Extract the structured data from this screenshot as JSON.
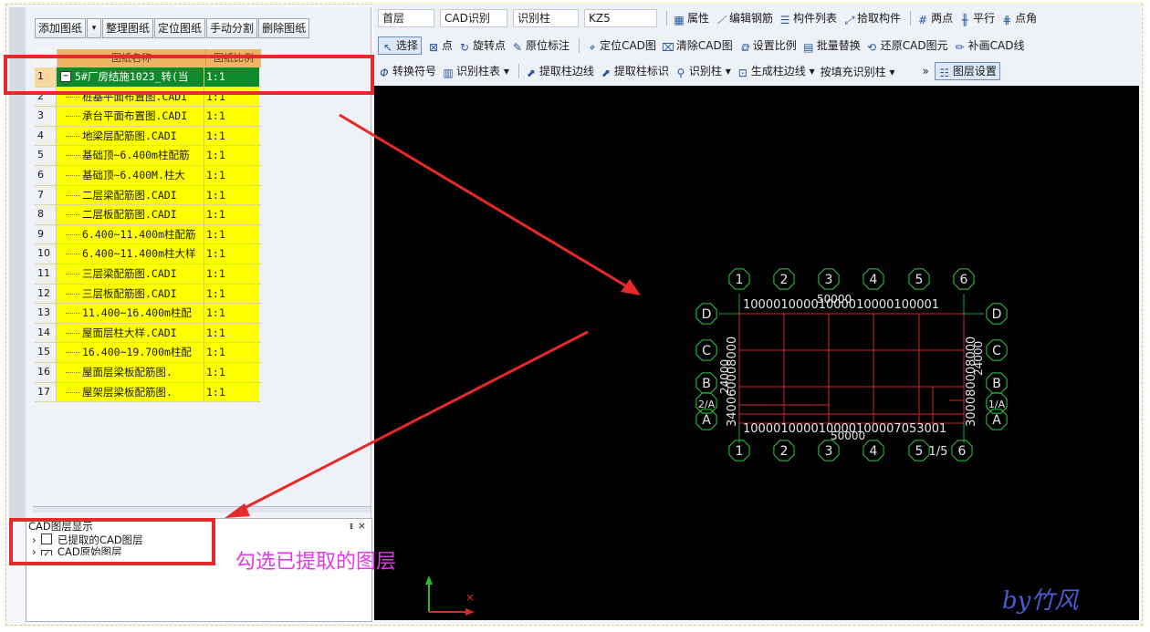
{
  "left_toolbar": {
    "add": "添加图纸",
    "dropdown": "▾",
    "organize": "整理图纸",
    "locate": "定位图纸",
    "split": "手动分割",
    "delete": "删除图纸"
  },
  "grid": {
    "headers": {
      "name": "图纸名称",
      "ratio": "图纸比例"
    },
    "rows": [
      {
        "n": "1",
        "name": "5#厂房结施1023_转(当",
        "ratio": "1:1"
      },
      {
        "n": "2",
        "name": "桩基平面布置图.CADI",
        "ratio": "1:1"
      },
      {
        "n": "3",
        "name": "承台平面布置图.CADI",
        "ratio": "1:1"
      },
      {
        "n": "4",
        "name": "地梁层配筋图.CADI",
        "ratio": "1:1"
      },
      {
        "n": "5",
        "name": "基础顶~6.400m柱配筋",
        "ratio": "1:1"
      },
      {
        "n": "6",
        "name": "基础顶~6.400M.柱大",
        "ratio": "1:1"
      },
      {
        "n": "7",
        "name": "二层梁配筋图.CADI",
        "ratio": "1:1"
      },
      {
        "n": "8",
        "name": "二层板配筋图.CADI",
        "ratio": "1:1"
      },
      {
        "n": "9",
        "name": "6.400~11.400m柱配筋",
        "ratio": "1:1"
      },
      {
        "n": "10",
        "name": "6.400~11.400m柱大样",
        "ratio": "1:1"
      },
      {
        "n": "11",
        "name": "三层梁配筋图.CADI",
        "ratio": "1:1"
      },
      {
        "n": "12",
        "name": "三层板配筋图.CADI",
        "ratio": "1:1"
      },
      {
        "n": "13",
        "name": "11.400~16.400m柱配",
        "ratio": "1:1"
      },
      {
        "n": "14",
        "name": "屋面层柱大样.CADI",
        "ratio": "1:1"
      },
      {
        "n": "15",
        "name": "16.400~19.700m柱配",
        "ratio": "1:1"
      },
      {
        "n": "16",
        "name": "屋面层梁板配筋图.",
        "ratio": "1:1"
      },
      {
        "n": "17",
        "name": "屋架层梁板配筋图.",
        "ratio": "1:1"
      }
    ]
  },
  "layer_panel": {
    "title": "CAD图层显示",
    "pin": "ᵻ",
    "close": "×",
    "item1": "已提取的CAD图层",
    "item2": "CAD原始图层"
  },
  "toolbar_row1": {
    "floor": "首层",
    "cad_recog": "CAD识别",
    "recog_col": "识别柱",
    "member": "KZ5",
    "props": "属性",
    "edit_rebar": "编辑钢筋",
    "member_list": "构件列表",
    "pick": "拾取构件",
    "two_point": "两点",
    "parallel": "平行",
    "point_angle": "点角"
  },
  "toolbar_row2": {
    "select": "选择",
    "point": "点",
    "rotate_point": "旋转点",
    "orig_mark": "原位标注",
    "locate_cad": "定位CAD图",
    "clear_cad": "清除CAD图",
    "set_ratio": "设置比例",
    "batch_replace": "批量替换",
    "restore_cad": "还原CAD图元",
    "supplement": "补画CAD线"
  },
  "toolbar_row3": {
    "convert_symbol": "转换符号",
    "recog_col_table": "识别柱表",
    "extract_edge": "提取柱边线",
    "extract_label": "提取柱标识",
    "recog_col": "识别柱",
    "gen_edge": "生成柱边线",
    "fill_recog": "按填充识别柱",
    "more": "»",
    "layer_settings": "图层设置"
  },
  "cad": {
    "top_axes": [
      "1",
      "2",
      "3",
      "4",
      "5",
      "6"
    ],
    "bottom_axes": [
      "1",
      "2",
      "3",
      "4",
      "5",
      "1/5",
      "6"
    ],
    "left_axes": [
      "D",
      "C",
      "B",
      "2/A",
      "A"
    ],
    "right_axes": [
      "D",
      "C",
      "B",
      "1/A",
      "A"
    ],
    "top_dim": "10000100001000010000100001",
    "top_total": "50000",
    "bottom_dim": "100001000010000100007053001",
    "bottom_total": "50000",
    "left_dims": "340060008000",
    "right_dims": "300080008000",
    "left_total": "24000",
    "right_total": "24000"
  },
  "annotation": {
    "note": "勾选已提取的图层",
    "signature": "by竹风"
  }
}
